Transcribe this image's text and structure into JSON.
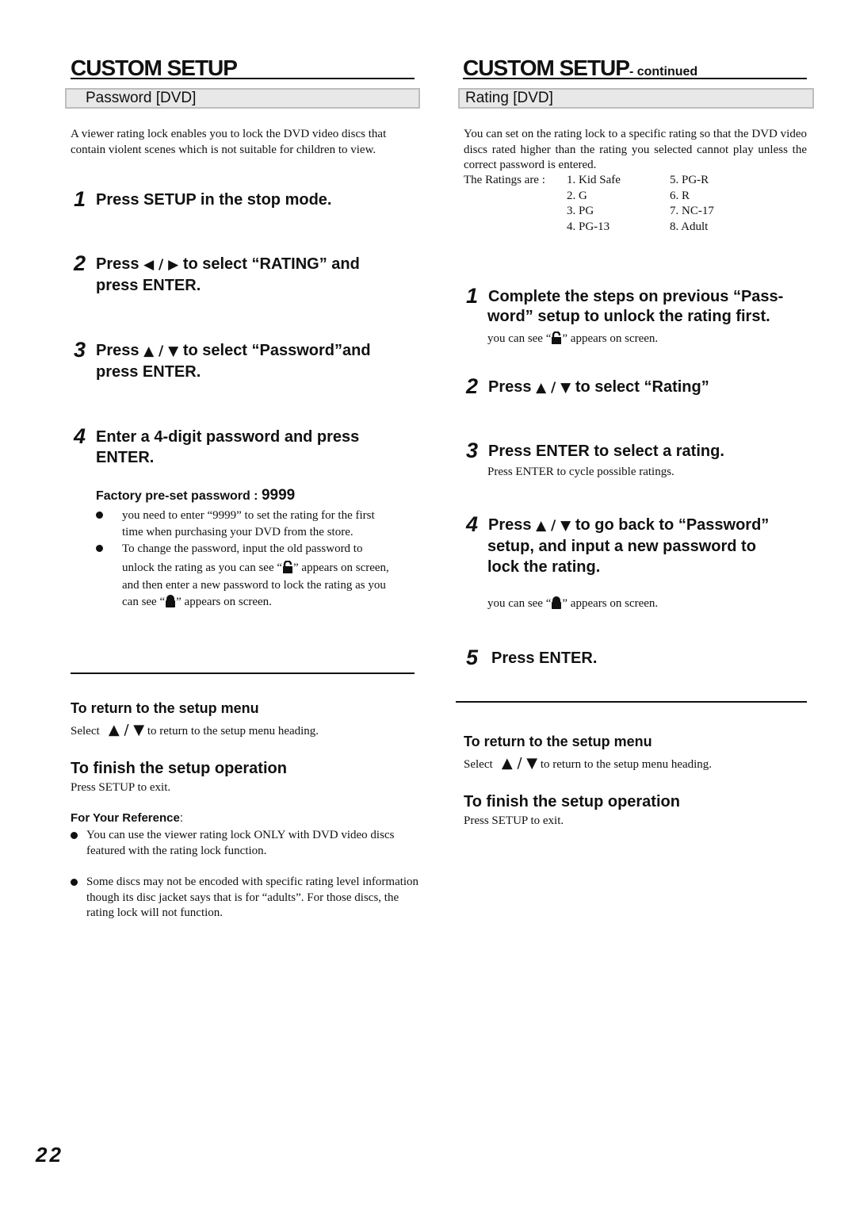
{
  "page_number": "22",
  "left": {
    "title": "CUSTOM SETUP",
    "section": "Password [DVD]",
    "intro": "A viewer rating lock enables you to lock the DVD video discs that contain violent scenes which is not suitable for children to view.",
    "steps": [
      {
        "num": "1",
        "line1": "Press SETUP in the stop mode."
      },
      {
        "num": "2",
        "pre": "Press",
        "arrows": "◀ / ▶",
        "post": " to select “RATING” and",
        "line2": "press ENTER."
      },
      {
        "num": "3",
        "pre": "Press",
        "arrows": "▲ / ▼",
        "post": "to select “Password”and",
        "line2": "press ENTER."
      },
      {
        "num": "4",
        "line1": "Enter a 4-digit password and press",
        "line2": "ENTER."
      }
    ],
    "factory_label": "Factory pre-set password : ",
    "factory_value": "9999",
    "bullets": [
      {
        "line1": "you need to enter “9999” to set the rating for the first",
        "line2": "time when purchasing your DVD from the store."
      },
      {
        "line1": "To change the password, input the old password to",
        "l2_pre": "unlock the rating as you can see “",
        "l2_post": "” appears on screen,",
        "line3": "and  then enter a new password to lock the rating as you",
        "l4_pre": "can see “",
        "l4_post": "” appears on screen."
      }
    ],
    "return_heading": "To return to the setup menu",
    "return_pre": "Select",
    "return_arrows": "▲ / ▼",
    "return_post": "to return to the setup menu heading.",
    "finish_heading": "To finish the setup operation",
    "finish_text": "Press SETUP to exit.",
    "reference_label": "For Your Reference",
    "reference_colon": ":",
    "reference_items": [
      "You can use the viewer rating lock ONLY with DVD video discs featured with the rating lock function.",
      "Some discs may not be encoded with specific rating level information though its disc jacket says that is for “adults”. For those discs, the rating lock will not function."
    ]
  },
  "right": {
    "title": "CUSTOM SETUP",
    "title_suffix": "- continued",
    "section": "Rating [DVD]",
    "intro": "You can set on the rating lock to a specific rating so that the DVD video discs rated higher than the rating you selected cannot play unless the correct password is entered.",
    "ratings_label": "The Ratings are :",
    "ratings": [
      "1. Kid Safe",
      "2. G",
      "3. PG",
      "4. PG-13",
      "5. PG-R",
      "6. R",
      "7. NC-17",
      "8. Adult"
    ],
    "steps": [
      {
        "num": "1",
        "line1": "Complete the steps on previous “Pass-",
        "line2": "word” setup to unlock the rating first.",
        "note_pre": "you can see “",
        "note_post": "” appears on screen."
      },
      {
        "num": "2",
        "pre": "Press",
        "arrows": "▲ / ▼",
        "post": " to select “Rating”"
      },
      {
        "num": "3",
        "line1": "Press ENTER to select a rating.",
        "note": "Press ENTER to cycle possible ratings."
      },
      {
        "num": "4",
        "pre": "Press",
        "arrows": "▲ / ▼",
        "post": " to go back to “Password”",
        "line2": "setup, and input a new password to",
        "line3": "lock the rating.",
        "note_pre": "you can see “",
        "note_post": "” appears on screen."
      },
      {
        "num": "5",
        "line1": "Press ENTER."
      }
    ],
    "return_heading": "To return to the setup menu",
    "return_pre": "Select",
    "return_arrows": "▲ / ▼",
    "return_post": "to return to the setup menu heading.",
    "finish_heading": "To finish the setup operation",
    "finish_text": "Press SETUP to exit."
  },
  "icons": {
    "unlock": "unlocked-padlock-icon",
    "lock": "locked-padlock-icon"
  }
}
